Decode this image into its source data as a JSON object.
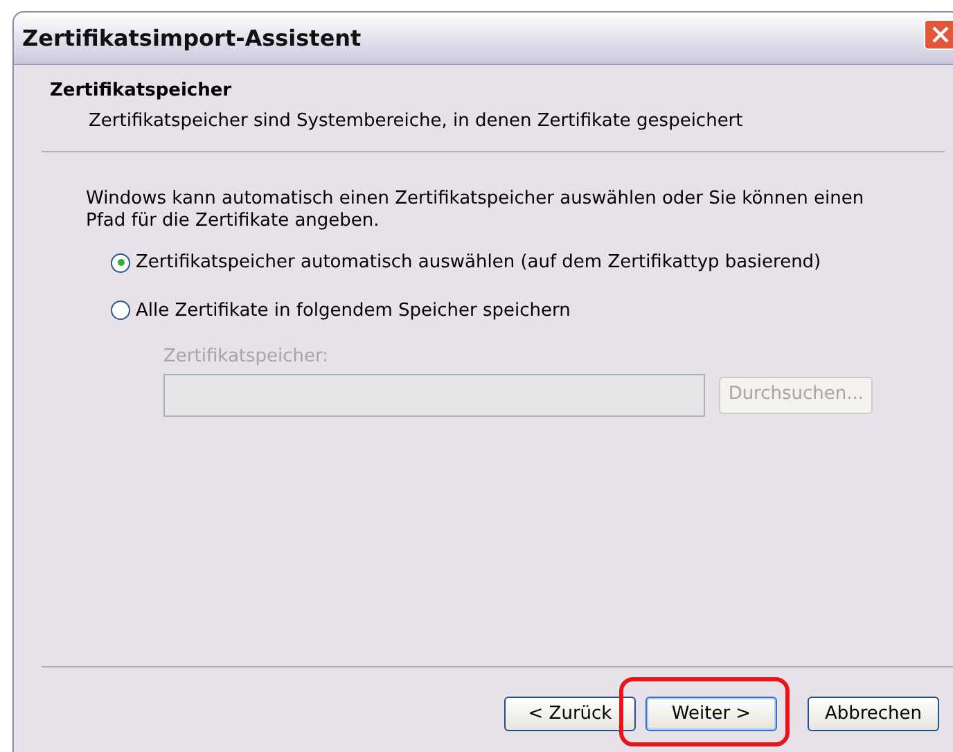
{
  "window": {
    "title": "Zertifikatsimport-Assistent"
  },
  "header": {
    "title": "Zertifikatspeicher",
    "subtitle": "Zertifikatspeicher sind Systembereiche, in denen Zertifikate gespeichert"
  },
  "intro": "Windows kann automatisch einen Zertifikatspeicher auswählen oder Sie können einen Pfad für die Zertifikate angeben.",
  "options": [
    {
      "label": "Zertifikatspeicher automatisch auswählen (auf dem Zertifikattyp basierend)",
      "selected": true
    },
    {
      "label": "Alle Zertifikate in folgendem Speicher speichern",
      "selected": false
    }
  ],
  "store": {
    "label": "Zertifikatspeicher:",
    "disabled": true,
    "browse": "Durchsuchen..."
  },
  "buttons": [
    {
      "label": "< Zurück",
      "default": false,
      "highlighted": false
    },
    {
      "label": "Weiter >",
      "default": true,
      "highlighted": true
    },
    {
      "label": "Abbrechen",
      "default": false,
      "highlighted": false
    }
  ]
}
